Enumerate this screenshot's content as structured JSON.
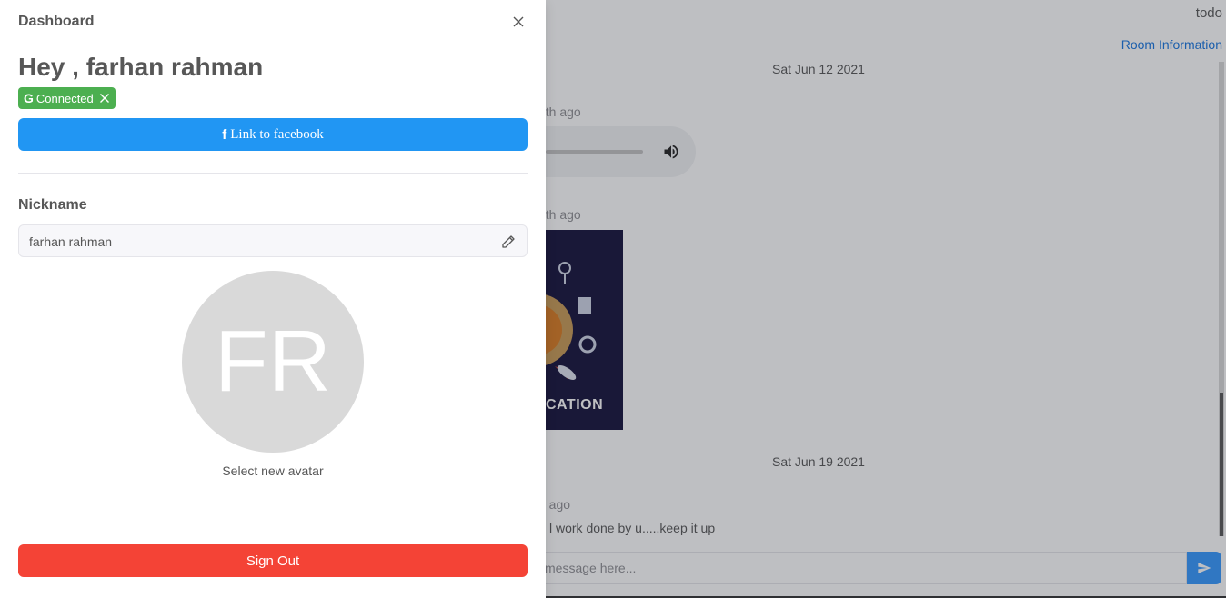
{
  "chat": {
    "room_title": "todo",
    "room_info_label": "Room Information",
    "date_1": "Sat Jun 12 2021",
    "msg1_time": "nth ago",
    "msg2_time": "nth ago",
    "image_caption": "CATION",
    "date_2": "Sat Jun 19 2021",
    "msg3_time": "h ago",
    "msg3_text": "l work done by u.....keep it up",
    "input_placeholder": "message here..."
  },
  "drawer": {
    "title": "Dashboard",
    "greeting": "Hey , farhan rahman",
    "provider_tag": {
      "icon": "G",
      "label": "Connected",
      "color": "#4caf50"
    },
    "facebook_button": {
      "icon": "f",
      "label": "Link to facebook",
      "color": "#2196f3"
    },
    "nickname_label": "Nickname",
    "nickname_value": "farhan rahman",
    "avatar_initials": "FR",
    "avatar_caption": "Select new avatar",
    "signout_label": "Sign Out",
    "signout_color": "#f44336"
  }
}
